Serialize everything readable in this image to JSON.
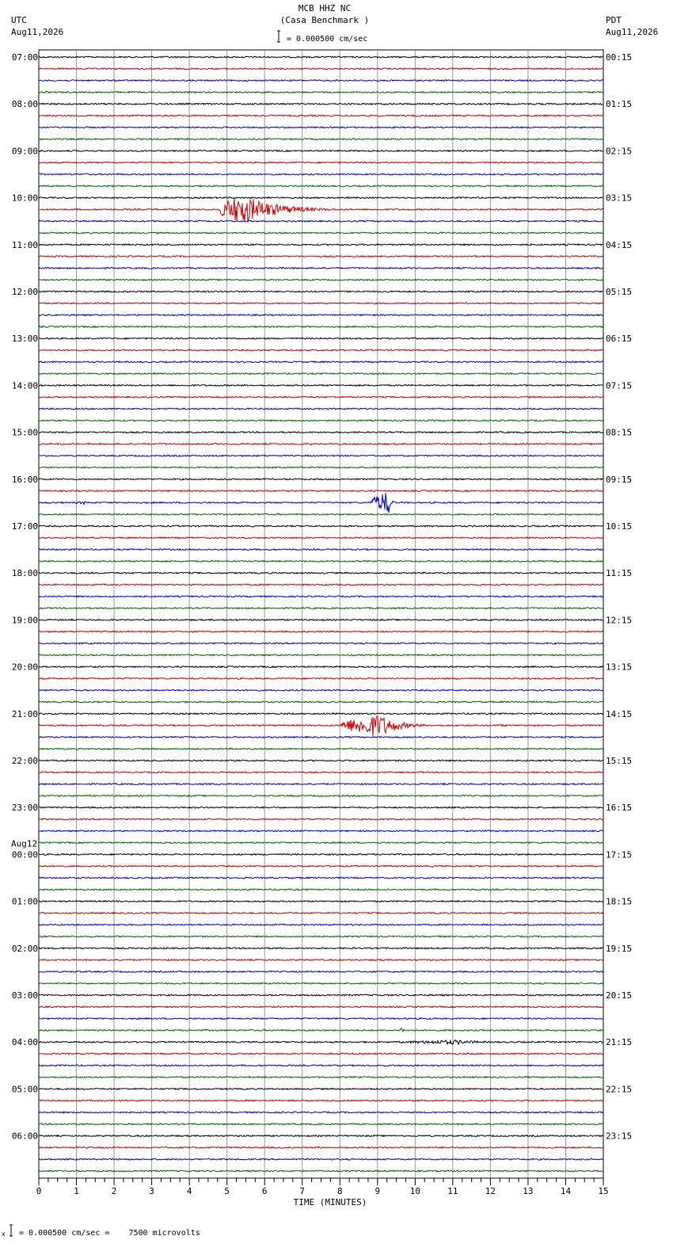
{
  "header": {
    "station": "MCB HHZ NC",
    "site": "(Casa Benchmark )",
    "left_zone": "UTC",
    "left_date": "Aug11,2026",
    "right_zone": "PDT",
    "right_date": "Aug11,2026",
    "scale_text": "= 0.000500 cm/sec"
  },
  "footer": {
    "scale_text": "= 0.000500 cm/sec =    7500 microvolts",
    "marker": "x"
  },
  "chart_data": {
    "type": "line",
    "xlabel": "TIME (MINUTES)",
    "xlim": [
      0,
      15
    ],
    "x_ticks": [
      "0",
      "1",
      "2",
      "3",
      "4",
      "5",
      "6",
      "7",
      "8",
      "9",
      "10",
      "11",
      "12",
      "13",
      "14",
      "15"
    ],
    "trace_colors": [
      "#000000",
      "#cc0000",
      "#0000cc",
      "#006600"
    ],
    "traces_per_hour": 4,
    "trace_count": 96,
    "day_break": {
      "label": "Aug12",
      "hour_index": 17
    },
    "left_hour_labels": [
      "07:00",
      "08:00",
      "09:00",
      "10:00",
      "11:00",
      "12:00",
      "13:00",
      "14:00",
      "15:00",
      "16:00",
      "17:00",
      "18:00",
      "19:00",
      "20:00",
      "21:00",
      "22:00",
      "23:00",
      "00:00",
      "01:00",
      "02:00",
      "03:00",
      "04:00",
      "05:00",
      "06:00"
    ],
    "right_hour_labels": [
      "00:15",
      "01:15",
      "02:15",
      "03:15",
      "04:15",
      "05:15",
      "06:15",
      "07:15",
      "08:15",
      "09:15",
      "10:15",
      "11:15",
      "12:15",
      "13:15",
      "14:15",
      "15:15",
      "16:15",
      "17:15",
      "18:15",
      "19:15",
      "20:15",
      "21:15",
      "22:15",
      "23:15"
    ],
    "events": [
      {
        "trace": 13,
        "start_min": 4.8,
        "end_min": 8.0,
        "peak_min": 5.4,
        "amplitude_traces": 1.3
      },
      {
        "trace": 38,
        "start_min": 1.0,
        "end_min": 1.4,
        "peak_min": 1.2,
        "amplitude_traces": 0.15
      },
      {
        "trace": 38,
        "start_min": 8.8,
        "end_min": 9.5,
        "peak_min": 9.3,
        "amplitude_traces": 1.0
      },
      {
        "trace": 39,
        "start_min": 6.3,
        "end_min": 6.4,
        "peak_min": 6.35,
        "amplitude_traces": 0.1
      },
      {
        "trace": 57,
        "start_min": 8.0,
        "end_min": 10.5,
        "peak_min": 9.05,
        "amplitude_traces": 1.0
      },
      {
        "trace": 57,
        "start_min": 11.6,
        "end_min": 12.6,
        "peak_min": 12.4,
        "amplitude_traces": 0.1
      },
      {
        "trace": 59,
        "start_min": 6.3,
        "end_min": 6.8,
        "peak_min": 6.5,
        "amplitude_traces": 0.08
      },
      {
        "trace": 83,
        "start_min": 9.6,
        "end_min": 9.7,
        "peak_min": 9.65,
        "amplitude_traces": 0.35
      },
      {
        "trace": 83,
        "start_min": 10.7,
        "end_min": 11.4,
        "peak_min": 10.9,
        "amplitude_traces": 0.1
      },
      {
        "trace": 84,
        "start_min": 9.5,
        "end_min": 13.0,
        "peak_min": 11.1,
        "amplitude_traces": 0.2
      },
      {
        "trace": 86,
        "start_min": 14.2,
        "end_min": 14.5,
        "peak_min": 14.35,
        "amplitude_traces": 0.08
      },
      {
        "trace": 90,
        "start_min": 5.5,
        "end_min": 5.8,
        "peak_min": 5.6,
        "amplitude_traces": 0.06
      },
      {
        "trace": 20,
        "start_min": 10.2,
        "end_min": 10.8,
        "peak_min": 10.5,
        "amplitude_traces": 0.05
      }
    ]
  }
}
